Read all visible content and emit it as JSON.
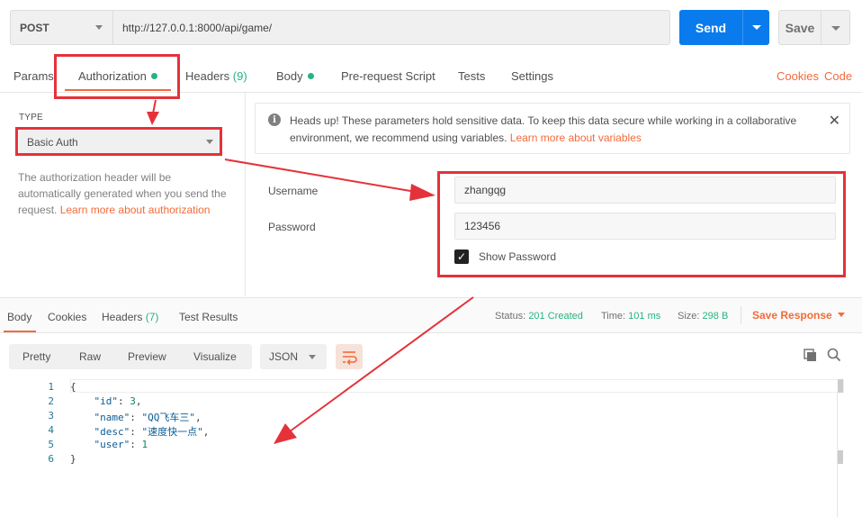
{
  "request": {
    "method": "POST",
    "url": "http://127.0.0.1:8000/api/game/",
    "send_label": "Send",
    "save_label": "Save"
  },
  "tabs": {
    "params": "Params",
    "authorization": "Authorization",
    "headers": "Headers",
    "headers_count": "(9)",
    "body": "Body",
    "pre_request": "Pre-request Script",
    "tests": "Tests",
    "settings": "Settings",
    "cookies": "Cookies",
    "code": "Code"
  },
  "auth": {
    "type_label": "TYPE",
    "type_value": "Basic Auth",
    "description": "The authorization header will be automatically generated when you send the request. ",
    "learn_more": "Learn more about authorization"
  },
  "notice": {
    "text": "Heads up! These parameters hold sensitive data. To keep this data secure while working in a collaborative environment, we recommend using variables. ",
    "link": "Learn more about variables"
  },
  "fields": {
    "username_label": "Username",
    "username_value": "zhangqg",
    "password_label": "Password",
    "password_value": "123456",
    "show_password": "Show Password",
    "show_password_checked": true
  },
  "response": {
    "tabs": {
      "body": "Body",
      "cookies": "Cookies",
      "headers": "Headers",
      "headers_count": "(7)",
      "test_results": "Test Results"
    },
    "status_label": "Status:",
    "status_value": "201 Created",
    "time_label": "Time:",
    "time_value": "101 ms",
    "size_label": "Size:",
    "size_value": "298 B",
    "save_response": "Save Response",
    "format_buttons": [
      "Pretty",
      "Raw",
      "Preview",
      "Visualize"
    ],
    "format_select": "JSON",
    "line_numbers": [
      "1",
      "2",
      "3",
      "4",
      "5",
      "6"
    ],
    "json": {
      "open": "{",
      "id_key": "\"id\"",
      "id_value": "3",
      "name_key": "\"name\"",
      "name_value": "\"QQ飞车三\"",
      "desc_key": "\"desc\"",
      "desc_value": "\"速度快一点\"",
      "user_key": "\"user\"",
      "user_value": "1",
      "close": "}"
    }
  },
  "colors": {
    "accent_orange": "#f26b3a",
    "send_blue": "#097bed",
    "status_green": "#26b47f",
    "annotation_red": "#e5323a"
  },
  "icons": [
    "chevron-down-icon",
    "info-icon",
    "close-icon",
    "check-icon",
    "wrap-lines-icon",
    "copy-icon",
    "search-icon"
  ]
}
